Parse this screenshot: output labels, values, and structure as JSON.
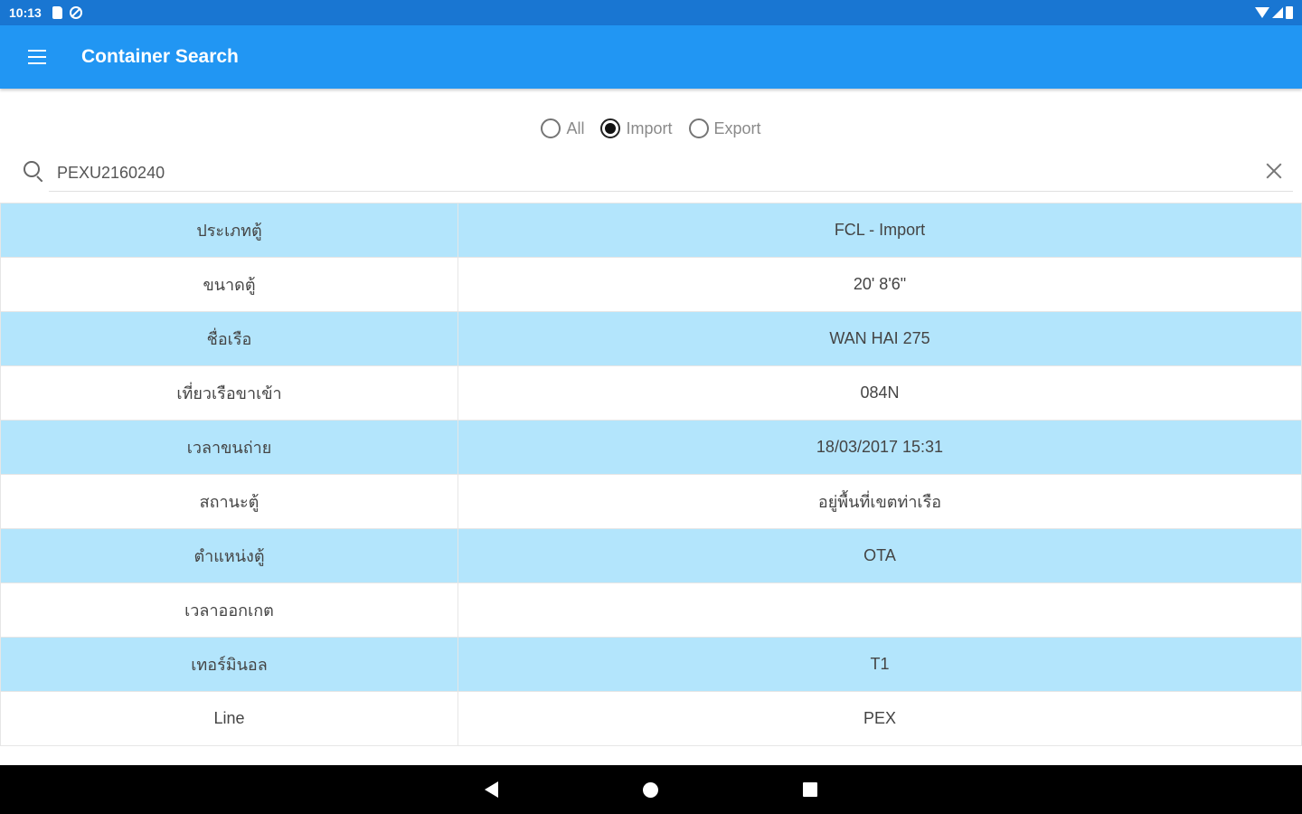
{
  "status_bar": {
    "time": "10:13",
    "icons": [
      "sd-card-icon",
      "sync-off-icon",
      "wifi-icon",
      "signal-icon",
      "battery-icon"
    ]
  },
  "app_bar": {
    "title": "Container Search",
    "color": "#2196f3",
    "menu_icon": "hamburger-menu-icon"
  },
  "filters": {
    "options": [
      {
        "label": "All",
        "checked": false
      },
      {
        "label": "Import",
        "checked": true
      },
      {
        "label": "Export",
        "checked": false
      }
    ],
    "selected": "Import"
  },
  "search": {
    "value": "PEXU2160240",
    "icon": "search-icon",
    "clear_icon": "close-icon"
  },
  "details": {
    "row_color_alt": "#b3e5fc",
    "rows": [
      {
        "label": "ประเภทตู้",
        "value": "FCL - Import"
      },
      {
        "label": "ขนาดตู้",
        "value": "20' 8'6\""
      },
      {
        "label": "ชื่อเรือ",
        "value": "WAN HAI 275"
      },
      {
        "label": "เที่ยวเรือขาเข้า",
        "value": "084N"
      },
      {
        "label": "เวลาขนถ่าย",
        "value": "18/03/2017 15:31"
      },
      {
        "label": "สถานะตู้",
        "value": "อยู่พื้นที่เขตท่าเรือ"
      },
      {
        "label": "ตำแหน่งตู้",
        "value": "OTA"
      },
      {
        "label": "เวลาออกเกต",
        "value": ""
      },
      {
        "label": "เทอร์มินอล",
        "value": "T1"
      },
      {
        "label": "Line",
        "value": "PEX"
      }
    ]
  },
  "nav_bar": {
    "buttons": [
      "back-icon",
      "home-icon",
      "recents-icon"
    ]
  }
}
